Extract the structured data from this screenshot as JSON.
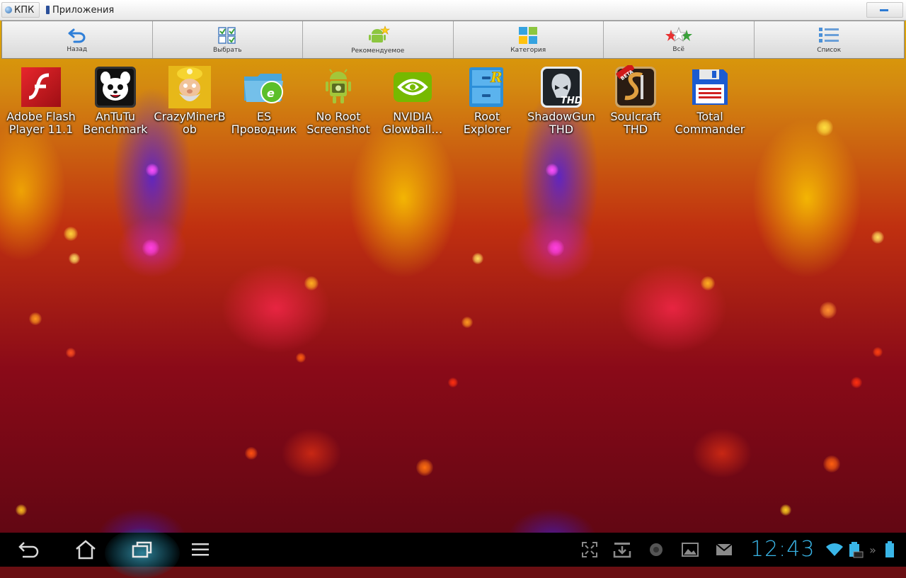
{
  "titlebar": {
    "kpk_label": "КПК",
    "apps_label": "Приложения"
  },
  "toolbar": {
    "items": [
      {
        "label": "Назад",
        "icon": "back-arrow-icon"
      },
      {
        "label": "Выбрать",
        "icon": "select-grid-icon"
      },
      {
        "label": "Рекомендуемое",
        "icon": "android-star-icon"
      },
      {
        "label": "Категория",
        "icon": "category-tiles-icon"
      },
      {
        "label": "Всё",
        "icon": "stars-icon"
      },
      {
        "label": "Список",
        "icon": "list-icon"
      }
    ]
  },
  "apps": [
    {
      "line1": "Adobe Flash",
      "line2": "Player 11.1",
      "icon": "flash-icon",
      "color": "#c4161c"
    },
    {
      "line1": "AnTuTu",
      "line2": "Benchmark",
      "icon": "antutu-icon",
      "color": "#222222"
    },
    {
      "line1": "CrazyMinerB",
      "line2": "ob",
      "icon": "crazyminer-icon",
      "color": "#d7a20e"
    },
    {
      "line1": "ES",
      "line2": "Проводник",
      "icon": "es-explorer-icon",
      "color": "#3fa0d8"
    },
    {
      "line1": "No Root",
      "line2": "Screenshot",
      "icon": "android-camera-icon",
      "color": "#8fbf2a"
    },
    {
      "line1": "NVIDIA",
      "line2": "Glowball…",
      "icon": "nvidia-icon",
      "color": "#76b900"
    },
    {
      "line1": "Root",
      "line2": "Explorer",
      "icon": "root-explorer-icon",
      "color": "#3a9ad8"
    },
    {
      "line1": "ShadowGun",
      "line2": "THD",
      "icon": "shadowgun-icon",
      "color": "#2a2f36"
    },
    {
      "line1": "Soulcraft",
      "line2": "THD",
      "icon": "soulcraft-icon",
      "color": "#3a2a1a"
    },
    {
      "line1": "Total",
      "line2": "Commander",
      "icon": "floppy-disk-icon",
      "color": "#1c5bd0"
    }
  ],
  "statusbar": {
    "time": "12:43",
    "accent": "#39b6e8"
  }
}
